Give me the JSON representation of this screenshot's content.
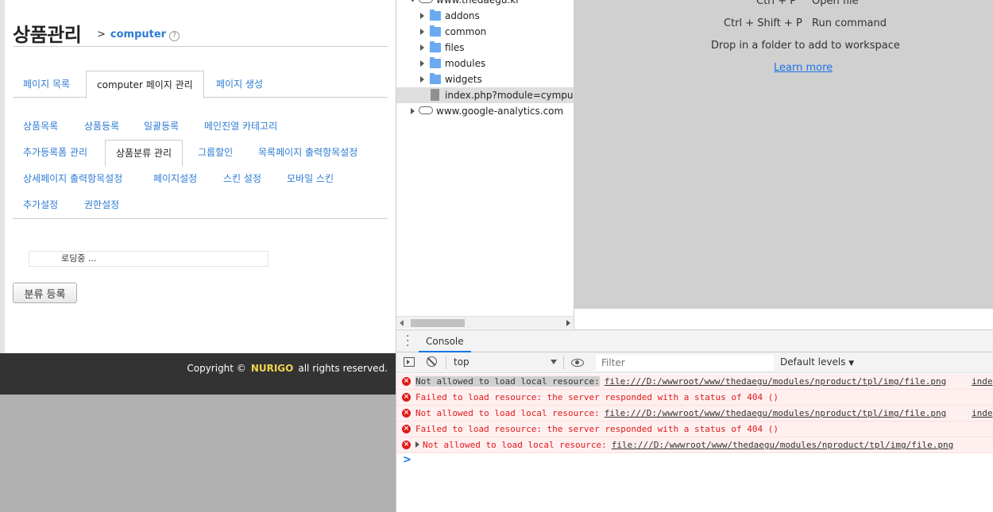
{
  "page": {
    "title": "상품관리",
    "breadcrumb_sep": ">",
    "breadcrumb_link": "computer",
    "help_icon": "?",
    "tabs": [
      {
        "label": "페이지 목록",
        "active": false
      },
      {
        "label": "computer 페이지 관리",
        "active": true
      },
      {
        "label": "페이지 생성",
        "active": false
      }
    ],
    "subtabs": [
      {
        "label": "상품목록"
      },
      {
        "label": "상품등록"
      },
      {
        "label": "일괄등록"
      },
      {
        "label": "메인진열 카테고리"
      },
      {
        "label": "추가등록폼 관리"
      },
      {
        "label": "상품분류 관리"
      },
      {
        "label": "그룹할인"
      },
      {
        "label": "목록페이지 출력항목설정"
      },
      {
        "label": "상세페이지 출력항목설정"
      },
      {
        "label": "페이지설정"
      },
      {
        "label": "스킨 설정"
      },
      {
        "label": "모바일 스킨"
      },
      {
        "label": "추가설정"
      },
      {
        "label": "권한설정"
      }
    ],
    "active_subtab": "상품분류 관리",
    "loading_text": "로딩중 ...",
    "register_button": "분류 등록",
    "footer": {
      "prefix": "Copyright ©",
      "brand": "NURIGO",
      "suffix": "all rights reserved."
    }
  },
  "tree": {
    "items": [
      {
        "label": "www.thedaegu.kr",
        "kind": "domain",
        "expanded": true
      },
      {
        "label": "addons",
        "kind": "folder"
      },
      {
        "label": "common",
        "kind": "folder"
      },
      {
        "label": "files",
        "kind": "folder"
      },
      {
        "label": "modules",
        "kind": "folder"
      },
      {
        "label": "widgets",
        "kind": "folder"
      },
      {
        "label": "index.php?module=cympusadmin",
        "kind": "file",
        "selected": true
      },
      {
        "label": "www.google-analytics.com",
        "kind": "domain",
        "expanded": false
      }
    ]
  },
  "editor": {
    "shortcuts": [
      {
        "keys": "Ctrl + P",
        "action": "Open file"
      },
      {
        "keys": "Ctrl + Shift + P",
        "action": "Run command"
      }
    ],
    "drop_hint": "Drop in a folder to add to workspace",
    "learn_more": "Learn more"
  },
  "console": {
    "tab_label": "Console",
    "context": "top",
    "filter_placeholder": "Filter",
    "levels": "Default levels",
    "levels_arrow": "▼",
    "messages": [
      {
        "text": "Not allowed to load local resource:",
        "link": "file:///D:/wwwroot/www/thedaegu/modules/nproduct/tpl/img/file.png",
        "source": "inde",
        "highlight": true
      },
      {
        "text": "Failed to load resource: the server responded with a status of 404 ()",
        "link": "",
        "source": ""
      },
      {
        "text": "Not allowed to load local resource:",
        "link": "file:///D:/wwwroot/www/thedaegu/modules/nproduct/tpl/img/file.png",
        "source": "inde"
      },
      {
        "text": "Failed to load resource: the server responded with a status of 404 ()",
        "link": "",
        "source": ""
      },
      {
        "text": "Not allowed to load local resource:",
        "link": "file:///D:/wwwroot/www/thedaegu/modules/nproduct/tpl/img/file.png",
        "source": "",
        "expandable": true
      }
    ],
    "prompt": ">"
  },
  "colors": {
    "link": "#2d7bd3",
    "error": "#e0191b",
    "error_bg": "#fff0f0",
    "brand": "#f0d34e",
    "footer_bg": "#333333",
    "folder": "#69aaf0"
  }
}
